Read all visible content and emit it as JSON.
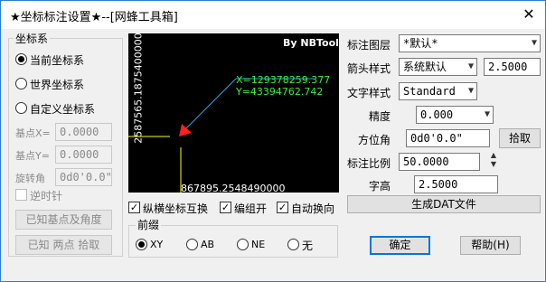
{
  "window": {
    "title": "★坐标标注设置★--[网蜂工具箱]",
    "close_glyph": "✕"
  },
  "coord_group": {
    "title": "坐标系",
    "options": [
      {
        "label": "当前坐标系",
        "selected": true
      },
      {
        "label": "世界坐标系",
        "selected": false
      },
      {
        "label": "自定义坐标系",
        "selected": false
      }
    ],
    "base_x_label": "基点X=",
    "base_x_value": "0.0000",
    "base_y_label": "基点Y=",
    "base_y_value": "0.0000",
    "rotation_label": "旋转角",
    "rotation_value": "0d0'0.0\"",
    "clockwise_label": "逆时针",
    "btn_known_base": "已知基点及角度",
    "btn_known_two": "已知 两点 拾取"
  },
  "preview": {
    "brand": "By NBTools",
    "x_text": "X=129378259.377",
    "y_text": "Y=43394762.742",
    "left_axis_text": "2587565.1875400000",
    "bottom_axis_text": "867895.2548490000",
    "colors": {
      "bg": "#000000",
      "text_green": "#3cf03c",
      "line_yellow": "#ffff00",
      "leader_cyan": "#29a8e0",
      "arrow_red": "#ff2020"
    }
  },
  "checks": [
    {
      "label": "纵横坐标互换",
      "checked": true
    },
    {
      "label": "编组开",
      "checked": true
    },
    {
      "label": "自动换向",
      "checked": true
    }
  ],
  "prefix_group": {
    "title": "前缀",
    "options": [
      {
        "label": "XY",
        "selected": true
      },
      {
        "label": "AB",
        "selected": false
      },
      {
        "label": "NE",
        "selected": false
      },
      {
        "label": "无",
        "selected": false
      }
    ]
  },
  "right": {
    "layer_label": "标注图层",
    "layer_value": "*默认*",
    "arrow_label": "箭头样式",
    "arrow_value": "系统默认",
    "arrow_size": "2.5000",
    "text_style_label": "文字样式",
    "text_style_value": "Standard",
    "precision_label": "精度",
    "precision_value": "0.000",
    "azimuth_label": "方位角",
    "azimuth_value": "0d0'0.0\"",
    "pick_button": "拾取",
    "scale_label": "标注比例",
    "scale_value": "50.0000",
    "height_label": "字高",
    "height_value": "2.5000",
    "gen_dat_button": "生成DAT文件",
    "ok_button": "确定",
    "help_button": "帮助(H)"
  }
}
